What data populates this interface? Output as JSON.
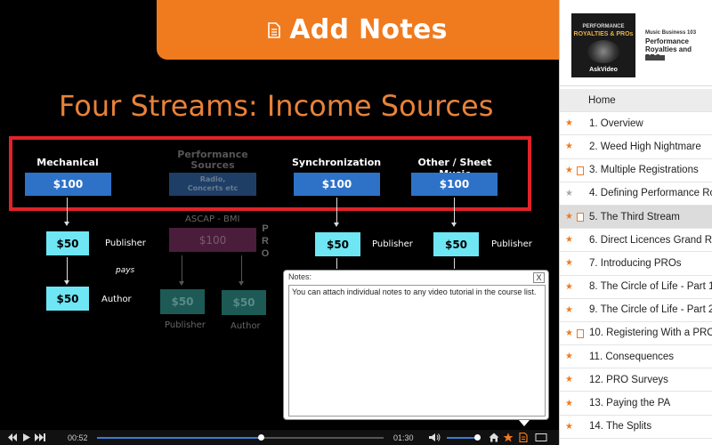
{
  "banner": {
    "title": "Add Notes",
    "icon": "document-icon"
  },
  "slide": {
    "title": "Four Streams: Income Sources",
    "columns": [
      {
        "heading": "Mechanical",
        "amount": "$100"
      },
      {
        "heading": "Performance Sources",
        "amount": "Radio, Concerts etc"
      },
      {
        "heading": "Synchronization",
        "amount": "$100"
      },
      {
        "heading": "Other / Sheet Music",
        "amount": "$100"
      }
    ],
    "ascap_label": "ASCAP - BMI",
    "pro_amount": "$100",
    "pro_vertical": "PRO",
    "mech_publisher_amount": "$50",
    "mech_publisher_label": "Publisher",
    "pays_label": "pays",
    "mech_author_amount": "$50",
    "mech_author_label": "Author",
    "perf_publisher_amount": "$50",
    "perf_publisher_label": "Publisher",
    "perf_author_amount": "$50",
    "perf_author_label": "Author",
    "sync_publisher_amount": "$50",
    "sync_publisher_label": "Publisher",
    "other_publisher_amount": "$50",
    "other_publisher_label": "Publisher"
  },
  "notes": {
    "label": "Notes:",
    "close_label": "X",
    "text": "You can attach individual notes to any video tutorial in the course list."
  },
  "controls": {
    "current_time": "00:52",
    "total_time": "01:30",
    "progress_percent": 57,
    "volume_percent": 90
  },
  "course": {
    "thumb_line1": "PERFORMANCE",
    "thumb_line2": "ROYALTIES & PROs",
    "thumb_brand": "AskVideo",
    "subtitle": "Music Business 103",
    "title": "Performance Royalties and PROs"
  },
  "lessons": [
    {
      "label": "Home",
      "star": "none",
      "note": false
    },
    {
      "label": "1. Overview",
      "star": "orange",
      "note": false
    },
    {
      "label": "2. Weed High Nightmare",
      "star": "orange",
      "note": false
    },
    {
      "label": "3. Multiple Registrations",
      "star": "orange",
      "note": true
    },
    {
      "label": "4. Defining Performance Ro",
      "star": "grey",
      "note": false
    },
    {
      "label": "5. The Third Stream",
      "star": "orange",
      "note": true
    },
    {
      "label": "6. Direct Licences Grand R",
      "star": "orange",
      "note": false
    },
    {
      "label": "7. Introducing PROs",
      "star": "orange",
      "note": false
    },
    {
      "label": "8. The Circle of Life - Part 1",
      "star": "orange",
      "note": false
    },
    {
      "label": "9. The Circle of Life - Part 2",
      "star": "orange",
      "note": false
    },
    {
      "label": "10. Registering With a PRO",
      "star": "orange",
      "note": true
    },
    {
      "label": "11. Consequences",
      "star": "orange",
      "note": false
    },
    {
      "label": "12. PRO Surveys",
      "star": "orange",
      "note": false
    },
    {
      "label": "13. Paying the PA",
      "star": "orange",
      "note": false
    },
    {
      "label": "14. The Splits",
      "star": "orange",
      "note": false
    }
  ],
  "active_lesson_index": 5,
  "colors": {
    "accent": "#f07a1e",
    "slide_blue": "#2e72c8",
    "slide_red": "#e0222a",
    "slide_cyan": "#6ee6f4"
  }
}
